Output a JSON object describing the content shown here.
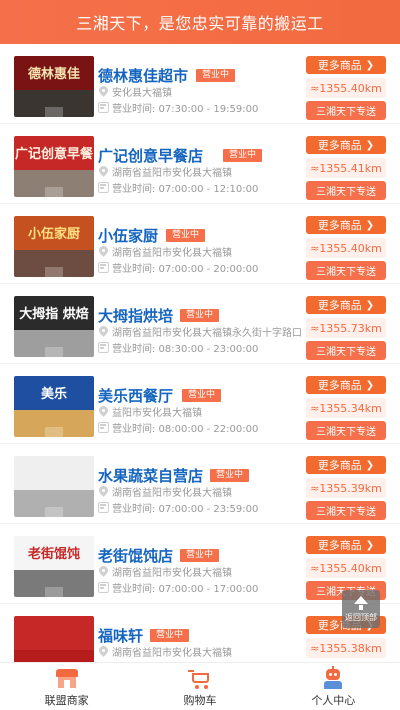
{
  "header": {
    "title": "三湘天下，是您忠实可靠的搬运工"
  },
  "colors": {
    "accent": "#f26a3f",
    "name_blue": "#1565c0",
    "muted": "#999999"
  },
  "shops": [
    {
      "name": "德林惠佳超市",
      "status": "营业中",
      "address": "安化县大福镇",
      "hours": "营业时间:  07:30:00 - 19:59:00",
      "more": "更多商品",
      "distance": "≈1355.40km",
      "deliver": "三湘天下专送",
      "sign_text": "德林惠佳",
      "sign_bg": "#7a1414",
      "sign_fg": "#f5e3b0",
      "front_bg": "#3a3530"
    },
    {
      "name": "广记创意早餐店",
      "status": "营业中",
      "address": "湖南省益阳市安化县大福镇",
      "hours": "营业时间:  07:00:00 - 12:10:00",
      "more": "更多商品",
      "distance": "≈1355.41km",
      "deliver": "三湘天下专送",
      "sign_text": "广记创意早餐",
      "sign_bg": "#c62828",
      "sign_fg": "#fff3e0",
      "front_bg": "#8d7f74"
    },
    {
      "name": "小伍家厨",
      "status": "营业中",
      "address": "湖南省益阳市安化县大福镇",
      "hours": "营业时间:  07:00:00 - 20:00:00",
      "more": "更多商品",
      "distance": "≈1355.40km",
      "deliver": "三湘天下专送",
      "sign_text": "小伍家厨",
      "sign_bg": "#c4511f",
      "sign_fg": "#ffe082",
      "front_bg": "#6d4c41"
    },
    {
      "name": "大拇指烘培",
      "status": "营业中",
      "address": "湖南省益阳市安化县大福镇永久街十字路口",
      "hours": "营业时间:  08:30:00 - 23:00:00",
      "more": "更多商品",
      "distance": "≈1355.73km",
      "deliver": "三湘天下专送",
      "sign_text": "大拇指 烘焙",
      "sign_bg": "#2b2b2b",
      "sign_fg": "#ffffff",
      "front_bg": "#9e9e9e"
    },
    {
      "name": "美乐西餐厅",
      "status": "营业中",
      "address": "益阳市安化县大福镇",
      "hours": "营业时间:  08:00:00 - 22:00:00",
      "more": "更多商品",
      "distance": "≈1355.34km",
      "deliver": "三湘天下专送",
      "sign_text": "美乐",
      "sign_bg": "#1e4fa0",
      "sign_fg": "#ffffff",
      "front_bg": "#d6a75a"
    },
    {
      "name": "水果蔬菜自营店",
      "status": "营业中",
      "address": "湖南省益阳市安化县大福镇",
      "hours": "营业时间:  07:00:00 - 23:59:00",
      "more": "更多商品",
      "distance": "≈1355.39km",
      "deliver": "三湘天下专送",
      "sign_text": "",
      "sign_bg": "#efefef",
      "sign_fg": "#555555",
      "front_bg": "#b0b0b0"
    },
    {
      "name": "老街馄饨店",
      "status": "营业中",
      "address": "湖南省益阳市安化县大福镇",
      "hours": "营业时间:  07:00:00 - 17:00:00",
      "more": "更多商品",
      "distance": "≈1355.40km",
      "deliver": "三湘天下专送",
      "sign_text": "老街馄饨",
      "sign_bg": "#f5f5f5",
      "sign_fg": "#c62828",
      "front_bg": "#7a7a7a"
    },
    {
      "name": "福味轩",
      "status": "营业中",
      "address": "湖南省益阳市安化县大福镇",
      "hours": "",
      "more": "更多商品",
      "distance": "≈1355.38km",
      "deliver": "",
      "sign_text": "",
      "sign_bg": "#c62828",
      "sign_fg": "#ffeb3b",
      "front_bg": "#b71c1c"
    }
  ],
  "back_to_top": {
    "label": "返回顶部",
    "icon": "arrow-up-icon"
  },
  "tabbar": {
    "items": [
      {
        "label": "联盟商家",
        "icon": "shop-icon"
      },
      {
        "label": "购物车",
        "icon": "cart-icon"
      },
      {
        "label": "个人中心",
        "icon": "user-icon"
      }
    ]
  }
}
